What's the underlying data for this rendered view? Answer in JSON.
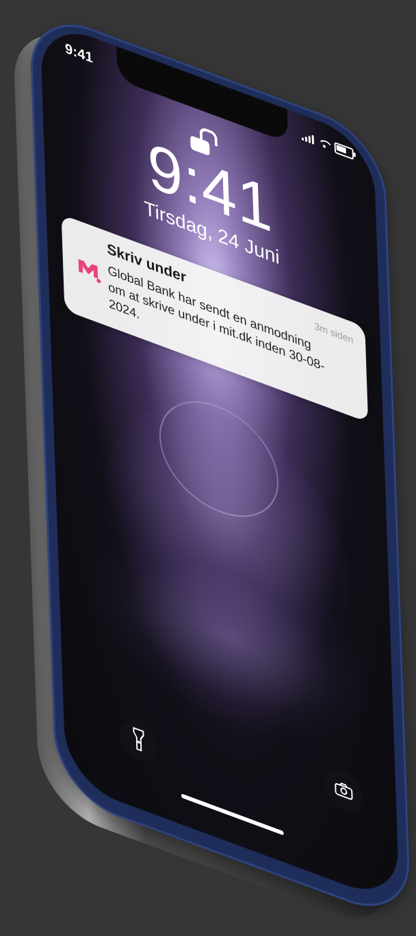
{
  "status_bar": {
    "time": "9:41",
    "icons": [
      "signal-icon",
      "wifi-icon",
      "battery-icon"
    ]
  },
  "lock_screen": {
    "lock_icon": "unlocked-lock-icon",
    "clock": "9:41",
    "date": "Tirsdag, 24 Juni"
  },
  "notification": {
    "app_icon": "mitdk-logo",
    "title": "Skriv under",
    "time_ago": "3m siden",
    "body": "Global Bank har sendt en anmodning om at skrive under i mit.dk inden 30-08-2024."
  },
  "quick_actions": {
    "left_icon": "flashlight-icon",
    "right_icon": "camera-icon"
  },
  "colors": {
    "background": "#363636",
    "phone_frame": "#1f2d5a",
    "app_accent": "#e8457a"
  }
}
